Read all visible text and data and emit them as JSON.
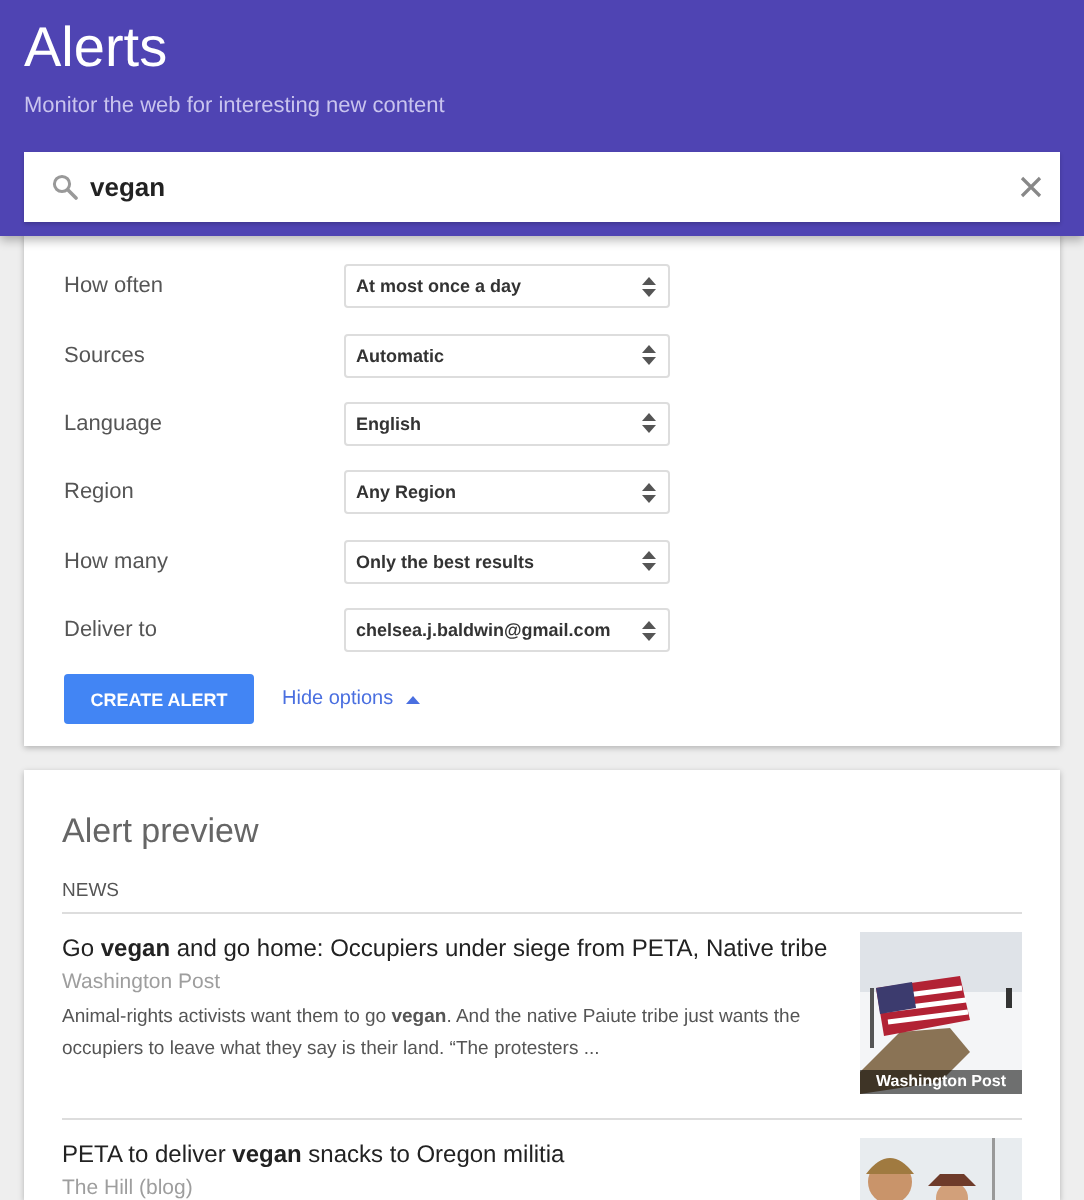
{
  "header": {
    "title": "Alerts",
    "subtitle": "Monitor the web for interesting new content"
  },
  "search": {
    "value": "vegan"
  },
  "options": [
    {
      "label": "How often",
      "value": "At most once a day"
    },
    {
      "label": "Sources",
      "value": "Automatic"
    },
    {
      "label": "Language",
      "value": "English"
    },
    {
      "label": "Region",
      "value": "Any Region"
    },
    {
      "label": "How many",
      "value": "Only the best results"
    },
    {
      "label": "Deliver to",
      "value": "chelsea.j.baldwin@gmail.com"
    }
  ],
  "create_button": "CREATE ALERT",
  "options_toggle": {
    "label": "Hide options",
    "expanded": true
  },
  "preview": {
    "title": "Alert preview",
    "section": "NEWS",
    "items": [
      {
        "title": "Go **vegan** and go home: Occupiers under siege from PETA, Native tribe",
        "source": "Washington Post",
        "snippet": "Animal-rights activists want them to go **vegan**. And the native Paiute tribe just wants the occupiers to leave what they say is their land. “The protesters ...",
        "image": {
          "kind": "picture",
          "caption": "Washington Post"
        }
      },
      {
        "title": "PETA to deliver **vegan** snacks to Oregon militia",
        "source": "The Hill (blog)"
      }
    ]
  }
}
